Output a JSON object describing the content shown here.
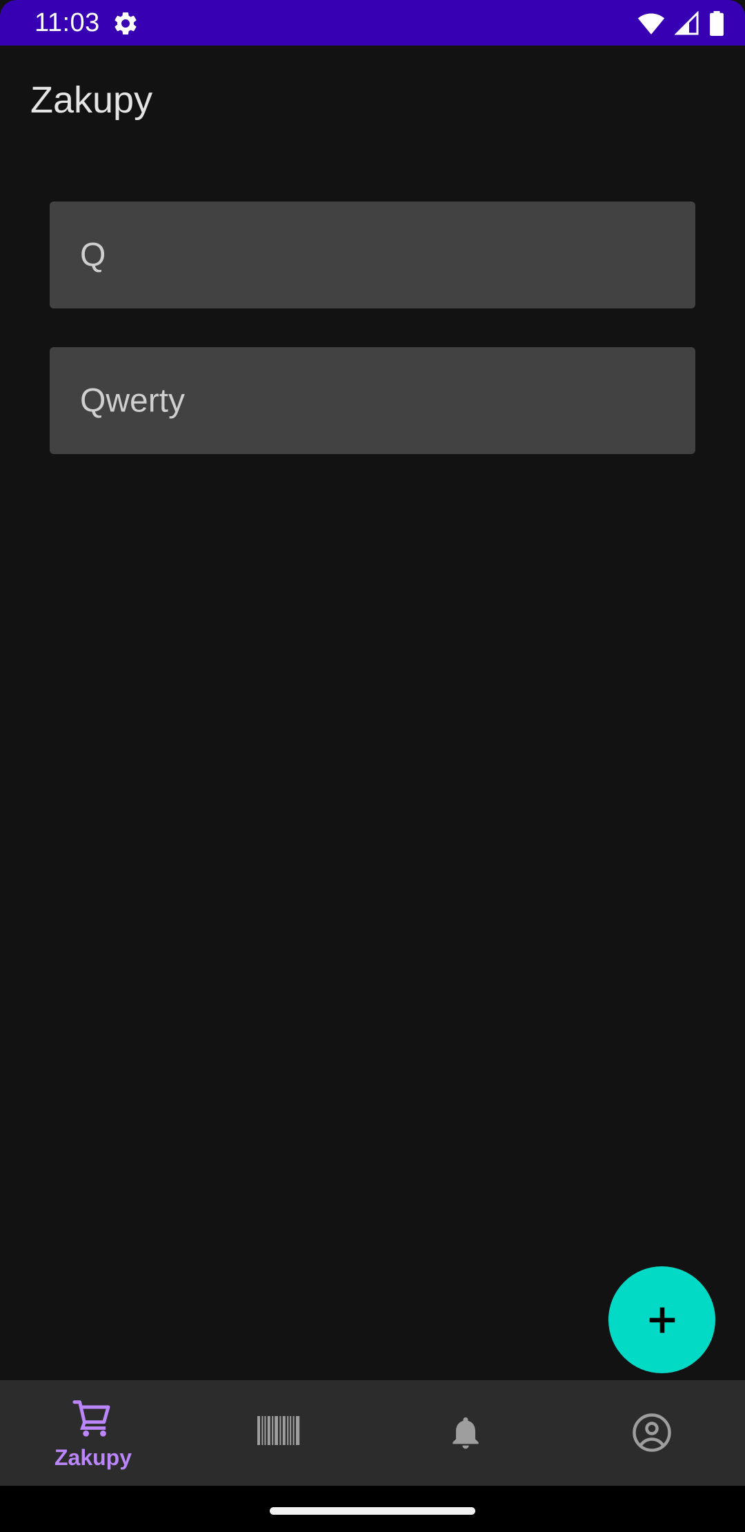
{
  "status_bar": {
    "time": "11:03",
    "background": "#3700B3",
    "icons": [
      "settings-gear-icon",
      "wifi-icon",
      "cellular-signal-icon",
      "battery-icon"
    ]
  },
  "app_bar": {
    "title": "Zakupy"
  },
  "lists": [
    {
      "name": "Q"
    },
    {
      "name": "Qwerty"
    }
  ],
  "fab": {
    "icon": "plus-icon",
    "color": "#03DAC5"
  },
  "bottom_nav": {
    "active_color": "#BB86FC",
    "inactive_color": "#9e9e9e",
    "items": [
      {
        "label": "Zakupy",
        "icon": "shopping-cart-icon",
        "active": true
      },
      {
        "label": "",
        "icon": "barcode-icon",
        "active": false
      },
      {
        "label": "",
        "icon": "bell-icon",
        "active": false
      },
      {
        "label": "",
        "icon": "account-circle-icon",
        "active": false
      }
    ]
  }
}
